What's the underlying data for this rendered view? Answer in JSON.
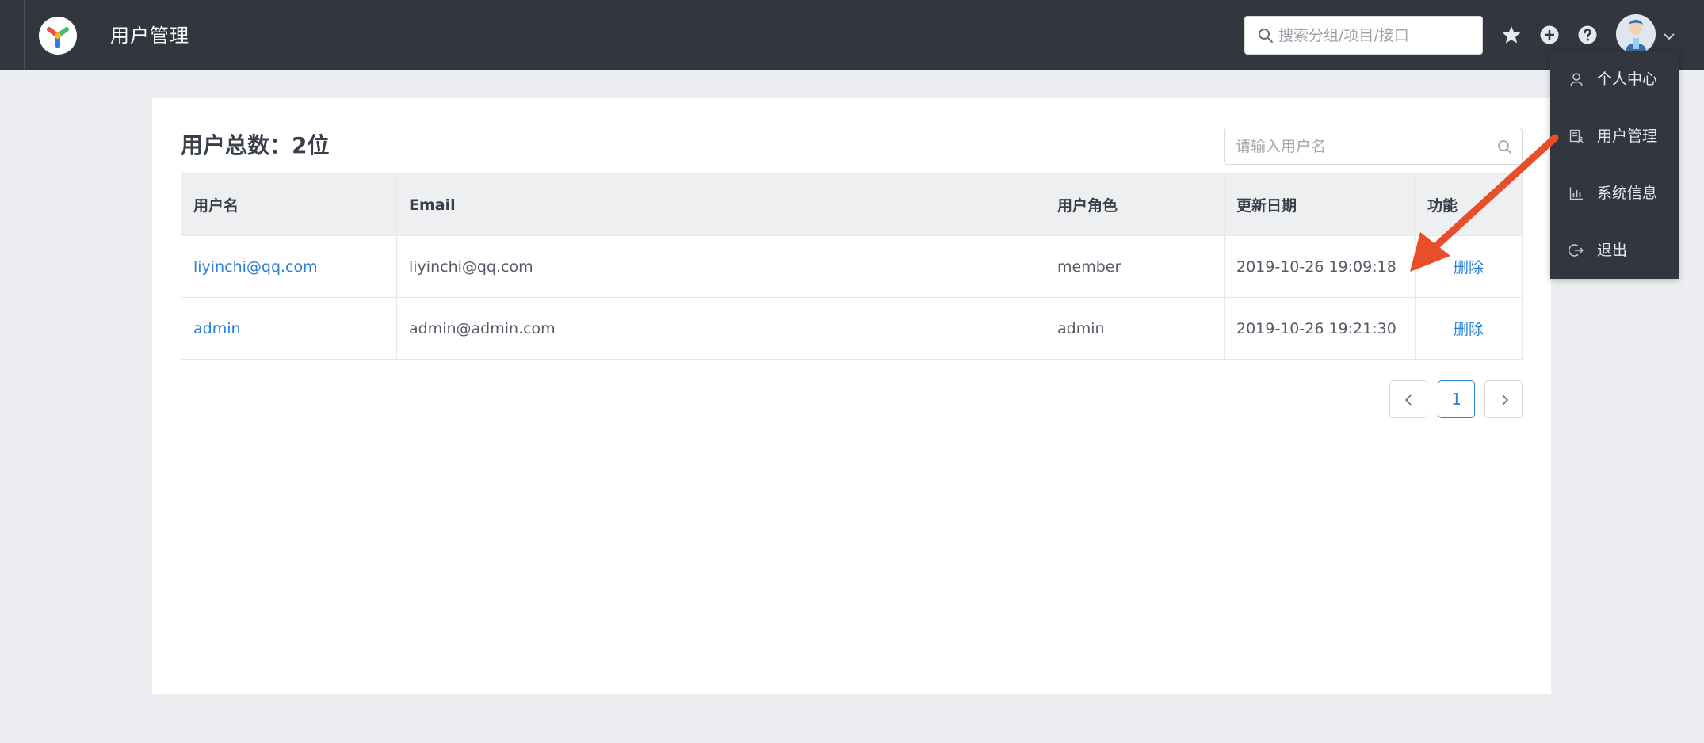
{
  "header": {
    "title": "用户管理",
    "search_placeholder": "搜索分组/项目/接口",
    "icons": [
      "star-icon",
      "plus-circle-icon",
      "help-icon"
    ]
  },
  "dropdown": {
    "items": [
      {
        "label": "个人中心",
        "icon": "user-icon"
      },
      {
        "label": "用户管理",
        "icon": "user-manage-icon"
      },
      {
        "label": "系统信息",
        "icon": "bar-chart-icon"
      },
      {
        "label": "退出",
        "icon": "logout-icon"
      }
    ]
  },
  "main": {
    "title": "用户总数：2位",
    "search_placeholder": "请输入用户名",
    "table": {
      "headers": [
        "用户名",
        "Email",
        "用户角色",
        "更新日期",
        "功能"
      ],
      "rows": [
        {
          "username": "liyinchi@qq.com",
          "email": "liyinchi@qq.com",
          "role": "member",
          "updated": "2019-10-26 19:09:18",
          "action": "删除"
        },
        {
          "username": "admin",
          "email": "admin@admin.com",
          "role": "admin",
          "updated": "2019-10-26 19:21:30",
          "action": "删除"
        }
      ]
    },
    "pagination": {
      "current_page": "1"
    }
  },
  "colors": {
    "topbar": "#31363f",
    "accent": "#2a7fd6",
    "annotation_arrow": "#e94e2a"
  }
}
